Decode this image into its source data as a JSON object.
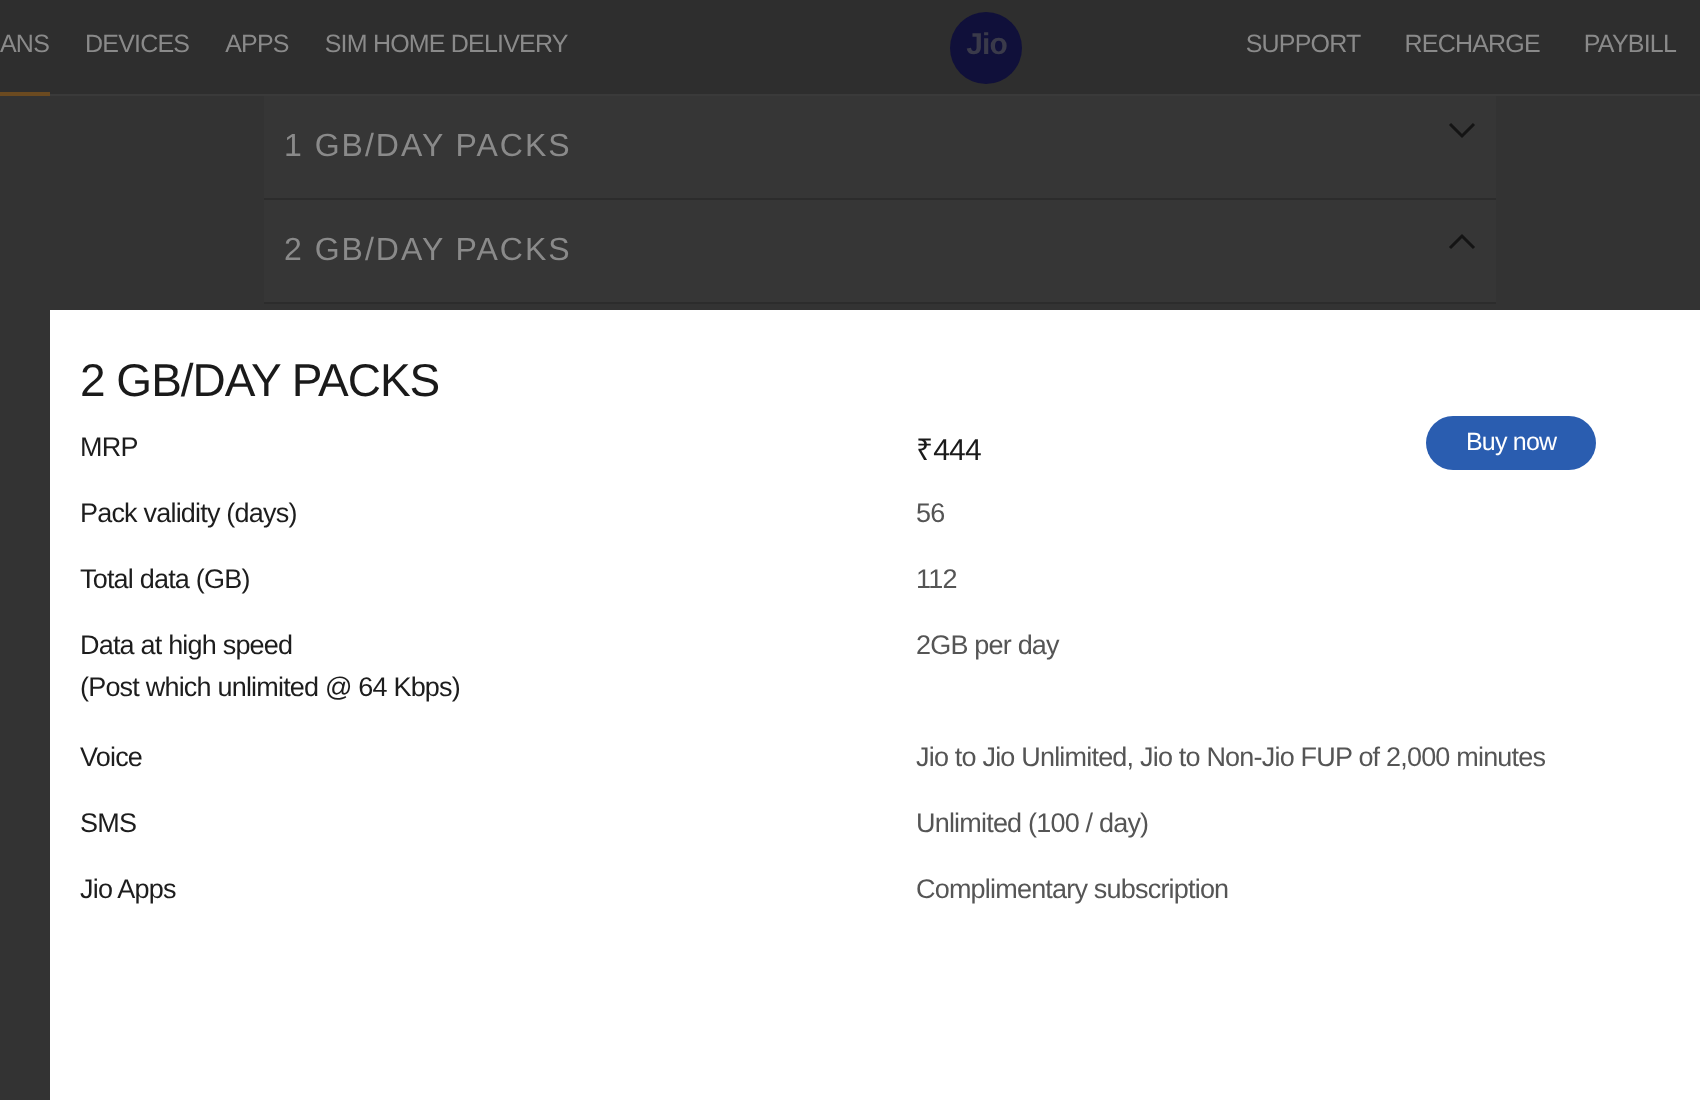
{
  "nav": {
    "left_links": [
      {
        "label": "ANS",
        "selected": true
      },
      {
        "label": "DEVICES",
        "selected": false
      },
      {
        "label": "APPS",
        "selected": false
      },
      {
        "label": "SIM HOME DELIVERY",
        "selected": false
      }
    ],
    "logo": "Jio",
    "right_links": [
      {
        "label": "SUPPORT",
        "selected": false
      },
      {
        "label": "RECHARGE",
        "selected": false
      },
      {
        "label": "PAYBILL",
        "selected": false
      }
    ]
  },
  "accordion": [
    {
      "title": "1 GB/DAY PACKS",
      "expanded": false
    },
    {
      "title": "2 GB/DAY PACKS",
      "expanded": true
    }
  ],
  "modal": {
    "title": "2 GB/DAY PACKS",
    "rows": [
      {
        "kind": "price",
        "label": "MRP",
        "value": "₹444",
        "button": "Buy now"
      },
      {
        "kind": "text",
        "label": "Pack validity (days)",
        "value": "56"
      },
      {
        "kind": "text",
        "label": "Total data (GB)",
        "value": "112"
      },
      {
        "kind": "text",
        "label": "Data at high speed",
        "note": "(Post which unlimited @ 64 Kbps)",
        "value": "2GB per day"
      },
      {
        "kind": "text",
        "label": "Voice",
        "value": "Jio to Jio Unlimited, Jio to Non-Jio FUP of 2,000 minutes"
      },
      {
        "kind": "text",
        "label": "SMS",
        "value": "Unlimited (100 / day)"
      },
      {
        "kind": "text",
        "label": "Jio Apps",
        "value": "Complimentary subscription"
      }
    ]
  }
}
